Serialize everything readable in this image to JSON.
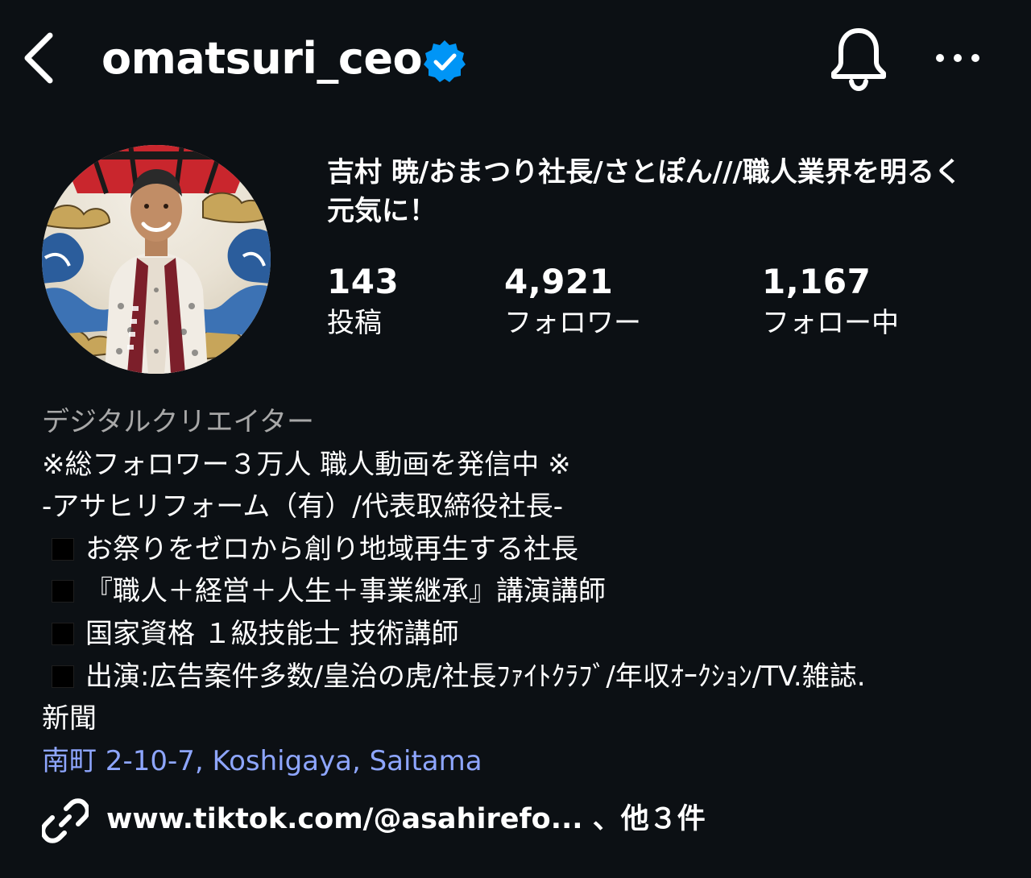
{
  "header": {
    "username": "omatsuri_ceo",
    "verified": true,
    "back_icon": "chevron-left-icon",
    "bell_icon": "bell-icon",
    "more_icon": "more-horizontal-icon"
  },
  "profile": {
    "display_name": "吉村 暁/おまつり社長/さとぽん///職人業界を明るく元気に！",
    "stats": {
      "posts": {
        "count": "143",
        "label": "投稿"
      },
      "followers": {
        "count": "4,921",
        "label": "フォロワー"
      },
      "following": {
        "count": "1,167",
        "label": "フォロー中"
      }
    }
  },
  "bio": {
    "category": "デジタルクリエイター",
    "lines": [
      "※総フォロワー３万人 職人動画を発信中 ※",
      "-アサヒリフォーム（有）/代表取締役社長-",
      "お祭りをゼロから創り地域再生する社長",
      "『職人＋経営＋人生＋事業継承』講演講師",
      "国家資格 １級技能士 技術講師",
      "出演:広告案件多数/皇治の虎/社長ﾌｧｲﾄｸﾗﾌﾞ/年収ｵｰｸｼｮﾝ/TV.雑誌.",
      "新聞"
    ],
    "location": "南町 2-10-7, Koshigaya, Saitama"
  },
  "links": {
    "text": "www.tiktok.com/@asahirefo... 、他３件",
    "icon": "link-icon"
  },
  "colors": {
    "background": "#0c1014",
    "text": "#ffffff",
    "secondary_text": "#a8a8a8",
    "link": "#8ea6ff",
    "verified_badge": "#0095f6"
  }
}
